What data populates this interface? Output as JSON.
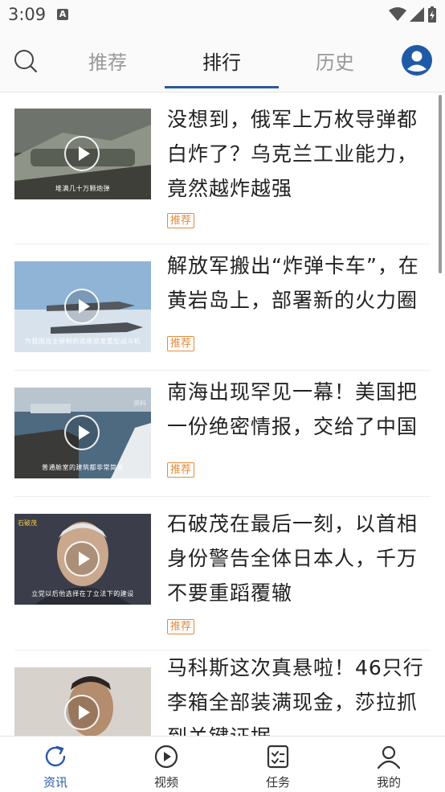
{
  "status_bar": {
    "time": "3:09",
    "notif_letter": "A"
  },
  "top_nav": {
    "tabs": [
      {
        "label": "推荐",
        "active": false
      },
      {
        "label": "排行",
        "active": true
      },
      {
        "label": "历史",
        "active": false
      }
    ]
  },
  "feed": {
    "items": [
      {
        "title_lines": [
          "没想到，俄军上万枚导弹都",
          "白炸了？乌克兰工业能力，",
          "竟然越炸越强"
        ],
        "tag": "推荐",
        "caption": "堆满几十万颗炮弹",
        "colors": {
          "sky": "#7a8078",
          "ground": "#3d3f38"
        }
      },
      {
        "title_lines": [
          "解放军搬出“炸弹卡车”，在",
          "黄岩岛上，部署新的火力圈"
        ],
        "tag": "推荐",
        "caption": "为我国自主研制的双座双发重型战斗机",
        "colors": {
          "sky": "#8fb4d6",
          "ground": "#cfdce8"
        }
      },
      {
        "title_lines": [
          "南海出现罕见一幕！美国把",
          "一份绝密情报，交给了中国"
        ],
        "tag": "推荐",
        "caption": "普通舱室的建筑都非常简单",
        "corner": "资料",
        "colors": {
          "sky": "#a9b9c6",
          "ground": "#4e6a80"
        }
      },
      {
        "title_lines": [
          "石破茂在最后一刻，以首相",
          "身份警告全体日本人，千万",
          "不要重蹈覆辙"
        ],
        "tag": "推荐",
        "caption": "立党以后他选择在了立法下的建设",
        "corner_tl": "石破茂",
        "colors": {
          "sky": "#3b3e4a",
          "ground": "#6f6a66"
        }
      },
      {
        "title_lines": [
          "马科斯这次真悬啦！46只行",
          "李箱全部装满现金，莎拉抓",
          "到关键证据"
        ],
        "tag": "",
        "caption": "",
        "colors": {
          "sky": "#d7d2cc",
          "ground": "#8a7f76"
        }
      }
    ]
  },
  "bottom_nav": {
    "items": [
      {
        "label": "资讯",
        "active": true
      },
      {
        "label": "视频",
        "active": false
      },
      {
        "label": "任务",
        "active": false
      },
      {
        "label": "我的",
        "active": false
      }
    ]
  },
  "colors": {
    "accent": "#2a5aa8",
    "tag": "#e48a3b"
  }
}
